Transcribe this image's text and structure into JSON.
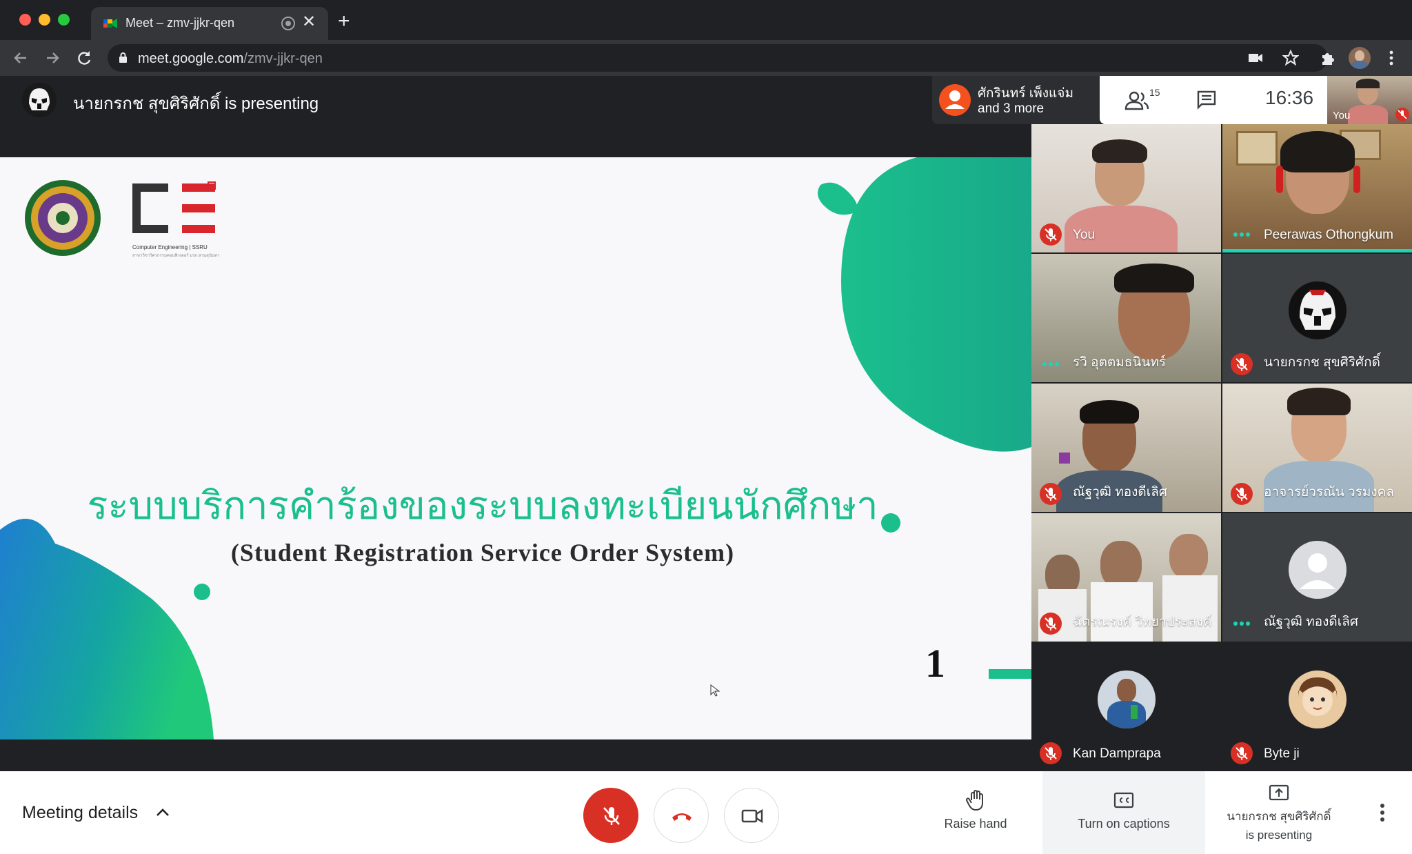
{
  "browser": {
    "tab_title": "Meet – zmv-jjkr-qen",
    "url_host": "meet.google.com",
    "url_path": "/zmv-jjkr-qen",
    "new_tab_symbol": "+",
    "close_symbol": "✕",
    "icons": [
      "back-icon",
      "forward-icon",
      "reload-icon",
      "lock-icon",
      "camera-icon",
      "star-icon",
      "extensions-icon",
      "profile-avatar",
      "menu-icon"
    ]
  },
  "meeting": {
    "presenter_line": "นายกรกช สุขศิริศักดิ์ is presenting",
    "chat_notice_name": "ศักรินทร์ เพ็งแจ่ม",
    "chat_notice_more": "and 3 more",
    "participant_count": "15",
    "time": "16:36",
    "self_label": "You"
  },
  "slide": {
    "title": "ระบบบริการคำร้องของระบบลงทะเบียนนักศึกษา",
    "subtitle": "(Student Registration Service Order System)",
    "page_number": "1",
    "logo_text_line1": "Computer Engineering | SSRU",
    "logo_text_line2": "สาขาวิชาวิศวกรรมคอมพิวเตอร์ มรภ.สวนสุนันทา",
    "accent_green": "#1bbf8c",
    "accent_blue": "#1f7fd0"
  },
  "participants": [
    {
      "name": "You",
      "status": "muted"
    },
    {
      "name": "Peerawas Othongkum",
      "status": "speaking"
    },
    {
      "name": "รวิ อุตตมธนินทร์",
      "status": "speaking"
    },
    {
      "name": "นายกรกช สุขศิริศักดิ์",
      "status": "muted"
    },
    {
      "name": "ณัฐวุฒิ ทองดีเลิศ",
      "status": "muted"
    },
    {
      "name": "อาจารย์วรณัน วรมงคล",
      "status": "muted"
    },
    {
      "name": "ฉัตรณรงค์ วิทยาประสงค์",
      "status": "muted"
    },
    {
      "name": "ณัฐวุฒิ ทองดีเลิศ",
      "status": "speaking"
    },
    {
      "name": "Kan Damprapa",
      "status": "muted"
    },
    {
      "name": "Byte ji",
      "status": "muted"
    }
  ],
  "bottom": {
    "meeting_details": "Meeting details",
    "raise_hand": "Raise hand",
    "captions": "Turn on captions",
    "presenting_line1": "นายกรกช สุขศิริศักดิ์",
    "presenting_line2": "is presenting"
  },
  "colors": {
    "end_call_red": "#d93025",
    "mic_off_red": "#d93025",
    "speaking_teal": "#1ed3b6"
  }
}
